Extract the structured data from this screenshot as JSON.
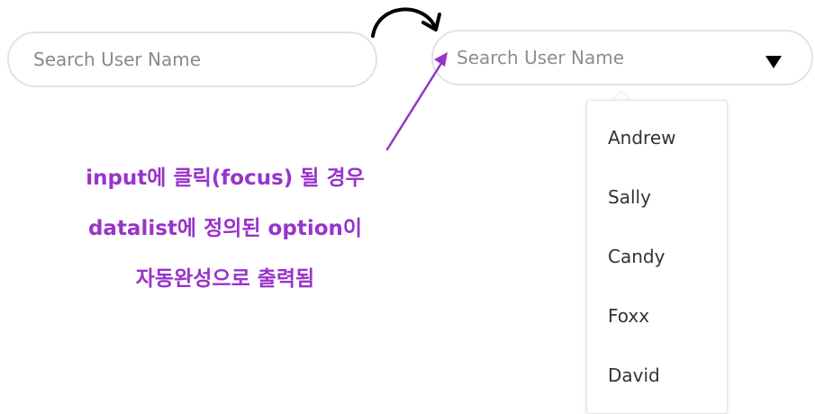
{
  "left_search": {
    "placeholder": "Search User Name"
  },
  "right_search": {
    "placeholder": "Search User Name",
    "dropdown_icon": "triangle-down-icon"
  },
  "datalist": {
    "options": [
      "Andrew",
      "Sally",
      "Candy",
      "Foxx",
      "David"
    ]
  },
  "annotation": {
    "lines": [
      "input에 클릭(focus) 될 경우",
      "datalist에 정의된 option이",
      "자동완성으로 출력됨"
    ],
    "color": "#9933cc"
  },
  "icons": {
    "curved_arrow": "curved-arrow-icon",
    "pointer_arrow": "pointer-arrow-icon"
  }
}
